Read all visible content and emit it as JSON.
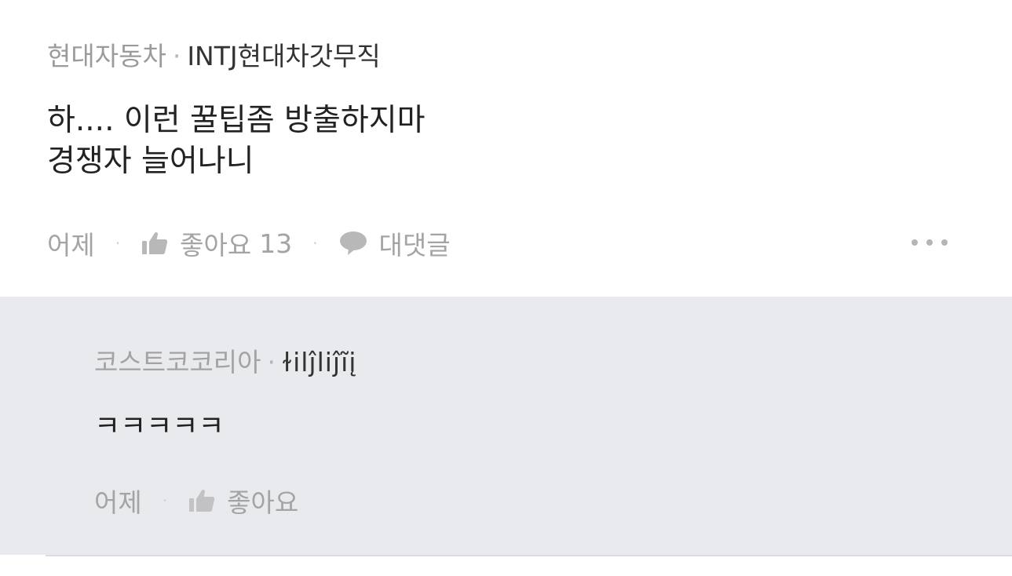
{
  "comment": {
    "company": "현대자동차",
    "separator": "·",
    "nickname": "INTJ현대차갓무직",
    "body_lines": [
      "하.... 이런 꿀팁좀 방출하지마",
      "경쟁자 늘어나니"
    ],
    "time": "어제",
    "like_label": "좋아요",
    "like_count": "13",
    "reply_label": "대댓글"
  },
  "reply": {
    "company": "코스트코코리아",
    "separator": "·",
    "nickname": "ɫilĵliĵĩį",
    "body": "ㅋㅋㅋㅋㅋ",
    "time": "어제",
    "like_label": "좋아요"
  },
  "icons": {
    "like": "thumbs-up-icon",
    "reply": "speech-bubble-icon",
    "more": "more-dots-icon"
  },
  "colors": {
    "reply_background": "#e9eaed",
    "muted_text": "#a4a4a4",
    "body_text": "#222222"
  }
}
